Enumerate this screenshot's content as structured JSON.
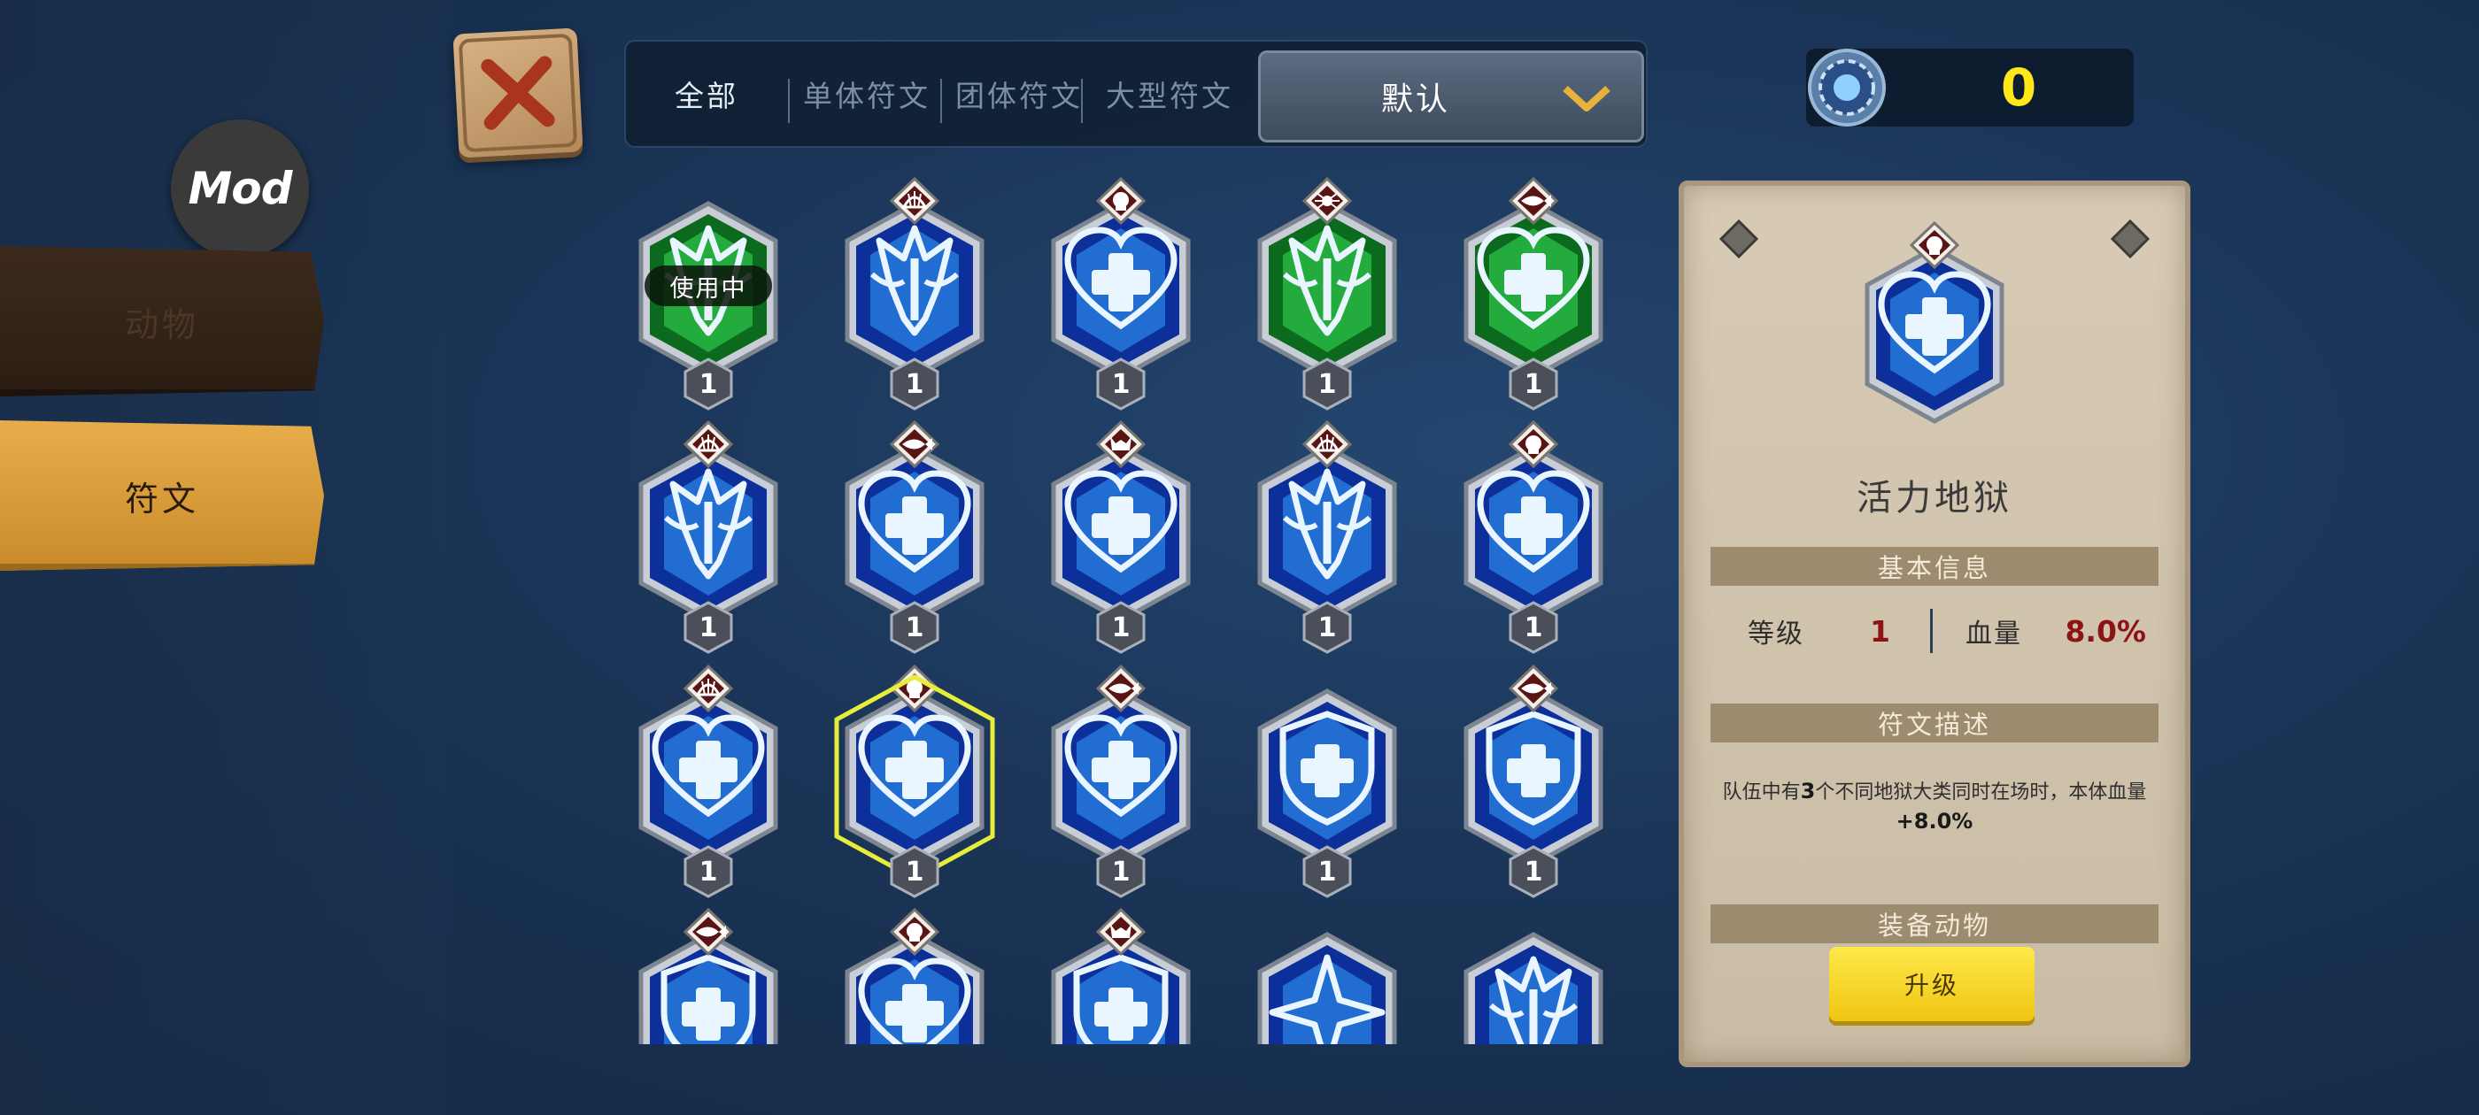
{
  "sidebar": {
    "mod_badge": "Mod",
    "categories": [
      {
        "label": "动物",
        "active": false
      },
      {
        "label": "符文",
        "active": true
      }
    ]
  },
  "filter_tabs": [
    {
      "label": "全部",
      "active": true
    },
    {
      "label": "单体符文",
      "active": false
    },
    {
      "label": "团体符文",
      "active": false
    },
    {
      "label": "大型符文",
      "active": false
    }
  ],
  "sort": {
    "selected": "默认"
  },
  "currency": {
    "icon": "gem-icon",
    "amount": "0"
  },
  "runes": [
    {
      "level": "1",
      "color": "green",
      "emblem": "crown",
      "badge": "none",
      "in_use": true,
      "in_use_label": "使用中",
      "selected": false
    },
    {
      "level": "1",
      "color": "blue",
      "emblem": "crown",
      "badge": "shell",
      "in_use": false,
      "selected": false
    },
    {
      "level": "1",
      "color": "blue",
      "emblem": "heart",
      "badge": "skull",
      "in_use": false,
      "selected": false
    },
    {
      "level": "1",
      "color": "green",
      "emblem": "crown",
      "badge": "spider",
      "in_use": false,
      "selected": false
    },
    {
      "level": "1",
      "color": "green",
      "emblem": "heart",
      "badge": "fish",
      "in_use": false,
      "selected": false
    },
    {
      "level": "1",
      "color": "blue",
      "emblem": "crown",
      "badge": "shell",
      "in_use": false,
      "selected": false
    },
    {
      "level": "1",
      "color": "blue",
      "emblem": "heart",
      "badge": "fish",
      "in_use": false,
      "selected": false
    },
    {
      "level": "1",
      "color": "blue",
      "emblem": "heart",
      "badge": "demon",
      "in_use": false,
      "selected": false
    },
    {
      "level": "1",
      "color": "blue",
      "emblem": "crown",
      "badge": "shell",
      "in_use": false,
      "selected": false
    },
    {
      "level": "1",
      "color": "blue",
      "emblem": "heart",
      "badge": "skull",
      "in_use": false,
      "selected": false
    },
    {
      "level": "1",
      "color": "blue",
      "emblem": "heart",
      "badge": "shell",
      "in_use": false,
      "selected": false
    },
    {
      "level": "1",
      "color": "blue",
      "emblem": "heart",
      "badge": "skull",
      "in_use": false,
      "selected": true
    },
    {
      "level": "1",
      "color": "blue",
      "emblem": "heart",
      "badge": "fish",
      "in_use": false,
      "selected": false
    },
    {
      "level": "1",
      "color": "blue",
      "emblem": "shield",
      "badge": "none",
      "in_use": false,
      "selected": false
    },
    {
      "level": "1",
      "color": "blue",
      "emblem": "shield",
      "badge": "fish",
      "in_use": false,
      "selected": false
    },
    {
      "level": "",
      "color": "blue",
      "emblem": "shield",
      "badge": "fish",
      "in_use": false,
      "selected": false
    },
    {
      "level": "",
      "color": "blue",
      "emblem": "heart",
      "badge": "skull",
      "in_use": false,
      "selected": false
    },
    {
      "level": "",
      "color": "blue",
      "emblem": "shield",
      "badge": "demon",
      "in_use": false,
      "selected": false
    },
    {
      "level": "",
      "color": "blue",
      "emblem": "star",
      "badge": "none",
      "in_use": false,
      "selected": false
    },
    {
      "level": "",
      "color": "blue",
      "emblem": "crown",
      "badge": "none",
      "in_use": false,
      "selected": false
    }
  ],
  "detail": {
    "name": "活力地狱",
    "badge": "skull",
    "emblem": "heart",
    "basic_info_header": "基本信息",
    "level_label": "等级",
    "level_value": "1",
    "hp_label": "血量",
    "hp_value": "8.0%",
    "desc_header": "符文描述",
    "desc_pre": "队伍中有",
    "desc_count": "3",
    "desc_mid": "个不同地狱大类同时在场时，本体血量",
    "desc_value": "+8.0%",
    "equip_header": "装备动物",
    "upgrade_label": "升级"
  },
  "colors": {
    "accent_yellow": "#ffe81a",
    "selected_outline": "#e8ec3a",
    "rune_blue": "#1f6fe0",
    "rune_green": "#1fbf3a",
    "stat_red": "#8c1414"
  }
}
